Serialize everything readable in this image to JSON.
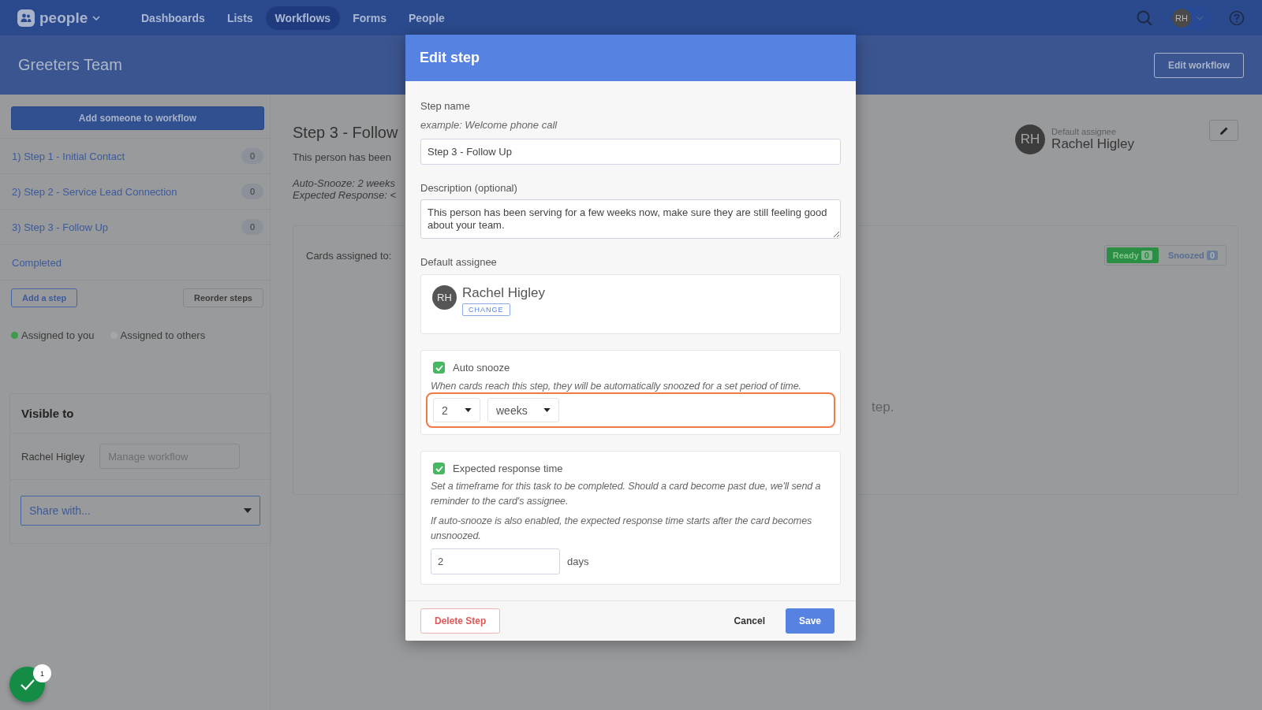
{
  "nav": {
    "app_name": "people",
    "items": [
      {
        "label": "Dashboards",
        "selected": false
      },
      {
        "label": "Lists",
        "selected": false
      },
      {
        "label": "Workflows",
        "selected": true
      },
      {
        "label": "Forms",
        "selected": false
      },
      {
        "label": "People",
        "selected": false
      }
    ],
    "user_initials": "RH"
  },
  "page": {
    "title": "Greeters Team",
    "edit_button": "Edit workflow"
  },
  "sidebar": {
    "add_button": "Add someone to workflow",
    "steps": [
      {
        "label": "1) Step 1 - Initial Contact",
        "count": "0"
      },
      {
        "label": "2) Step 2 - Service Lead Connection",
        "count": "0"
      },
      {
        "label": "3) Step 3 - Follow Up",
        "count": "0"
      }
    ],
    "completed": "Completed",
    "add_step": "Add a step",
    "reorder": "Reorder steps",
    "legend": [
      {
        "label": "Assigned to you",
        "color": "#3f9b4c"
      },
      {
        "label": "Assigned to others",
        "color": "#a3a6ab"
      }
    ]
  },
  "visible_to": {
    "title": "Visible to",
    "rows": [
      {
        "name": "Rachel Higley",
        "placeholder": "Manage workflow"
      }
    ],
    "share": "Share with..."
  },
  "step_detail": {
    "title": "Step 3 - Follow",
    "description": "This person has been",
    "auto_snooze": "Auto-Snooze: 2 weeks",
    "expected_response": "Expected Response: <",
    "assignee_label": "Default assignee",
    "assignee_name": "Rachel Higley",
    "assignee_initials": "RH",
    "cards_label": "Cards assigned to:",
    "filters": [
      {
        "label": "Ready",
        "count": "0",
        "selected": true
      },
      {
        "label": "Snoozed",
        "count": "0",
        "selected": false
      }
    ],
    "empty_message": "tep."
  },
  "modal": {
    "title": "Edit step",
    "step_name": {
      "label": "Step name",
      "hint": "example: Welcome phone call",
      "value": "Step 3 - Follow Up"
    },
    "description": {
      "label": "Description (optional)",
      "value": "This person has been serving for a few weeks now, make sure they are still feeling good about your team."
    },
    "assignee": {
      "label": "Default assignee",
      "initials": "RH",
      "name": "Rachel Higley",
      "change": "CHANGE"
    },
    "auto_snooze": {
      "checked": true,
      "label": "Auto snooze",
      "help": "When cards reach this step, they will be automatically snoozed for a set period of time.",
      "amount": "2",
      "unit": "weeks",
      "highlighted": true
    },
    "expected_response": {
      "checked": true,
      "label": "Expected response time",
      "help": [
        "Set a timeframe for this task to be completed. Should a card become past due, we'll send a reminder to the card's assignee.",
        "If auto-snooze is also enabled, the expected response time starts after the card becomes unsnoozed."
      ],
      "value": "2",
      "unit": "days"
    },
    "delete": "Delete Step",
    "cancel": "Cancel",
    "save": "Save"
  },
  "tasks_badge": "1"
}
